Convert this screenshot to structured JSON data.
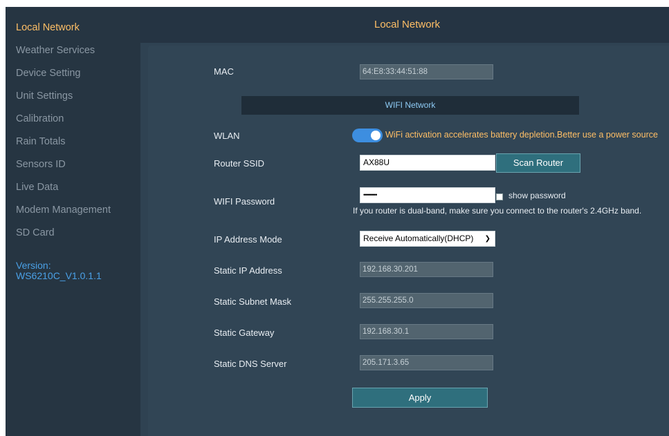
{
  "sidebar": {
    "items": [
      {
        "label": "Local Network",
        "active": true
      },
      {
        "label": "Weather Services"
      },
      {
        "label": "Device Setting"
      },
      {
        "label": "Unit Settings"
      },
      {
        "label": "Calibration"
      },
      {
        "label": "Rain Totals"
      },
      {
        "label": "Sensors ID"
      },
      {
        "label": "Live Data"
      },
      {
        "label": "Modem Management"
      },
      {
        "label": "SD Card"
      }
    ],
    "version_label": "Version:",
    "version_value": "WS6210C_V1.0.1.1"
  },
  "header": {
    "title": "Local Network"
  },
  "form": {
    "mac": {
      "label": "MAC",
      "value": "64:E8:33:44:51:88"
    },
    "wifi_section": "WIFI Network",
    "wlan": {
      "label": "WLAN",
      "enabled": true,
      "warning": "WiFi activation accelerates battery depletion.Better use a power source"
    },
    "ssid": {
      "label": "Router SSID",
      "value": "AX88U",
      "scan_label": "Scan Router"
    },
    "password": {
      "label": "WIFI Password",
      "masked": "•••••••••",
      "show_label": "show password",
      "note": "If you router is dual-band, make sure you connect to the router's 2.4GHz band."
    },
    "ip_mode": {
      "label": "IP Address Mode",
      "selected": "Receive Automatically(DHCP)"
    },
    "static_ip": {
      "label": "Static IP Address",
      "value": "192.168.30.201"
    },
    "subnet": {
      "label": "Static Subnet Mask",
      "value": "255.255.255.0"
    },
    "gateway": {
      "label": "Static Gateway",
      "value": "192.168.30.1"
    },
    "dns": {
      "label": "Static DNS Server",
      "value": "205.171.3.65"
    },
    "apply_label": "Apply"
  },
  "colors": {
    "accent": "#ffbf66",
    "link": "#4aa0e6",
    "toggle_on": "#3d8ee0",
    "button": "#2f6f7d"
  }
}
